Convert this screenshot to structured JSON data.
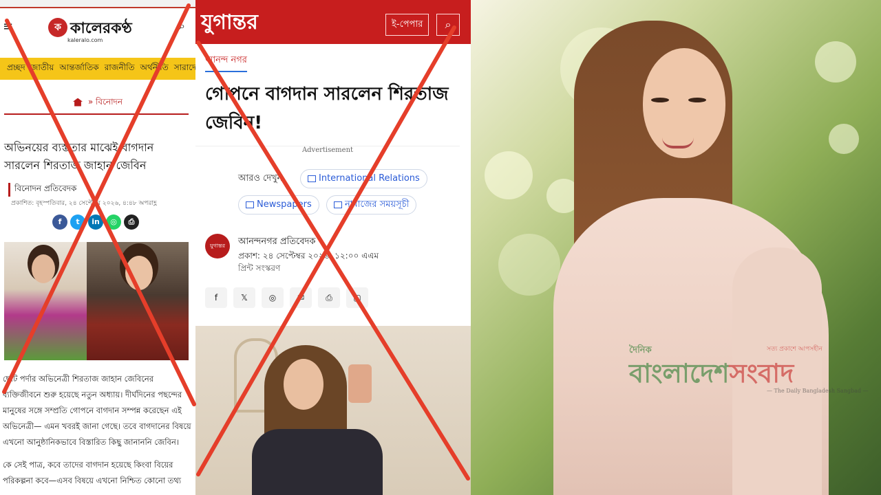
{
  "left": {
    "logo_text": "কালেরকণ্ঠ",
    "logo_sub": "kaleralo.com",
    "nav": [
      "প্রচ্ছদ",
      "জাতীয়",
      "আন্তর্জাতিক",
      "রাজনীতি",
      "অর্থনীতি",
      "সারাদেশ"
    ],
    "breadcrumb": "বিনোদন",
    "headline": "অভিনয়ের ব্যস্ততার মাঝেই বাগদান সারলেন শিরতাজ জাহান জেবিন",
    "author": "বিনোদন প্রতিবেদক",
    "date": "প্রকাশিত: বৃহস্পতিবার, ২৪ সেপ্টেম্বর ২০২৬, ৪:৪৮ অপরাহ্ণ",
    "body_p1": "ছোট পর্দার অভিনেত্রী শিরতাজ জাহান জেবিনের ব্যক্তিজীবনে শুরু হয়েছে নতুন অধ্যায়। দীর্ঘদিনের পছন্দের মানুষের সঙ্গে সম্প্রতি গোপনে বাগদান সম্পন্ন করেছেন এই অভিনেত্রী— এমন খবরই জানা গেছে। তবে বাগদানের বিষয়ে এখনো আনুষ্ঠানিকভাবে বিস্তারিত কিছু জানাননি জেবিন।",
    "body_p2": "কে সেই পাত্র, কবে তাদের বাগদান হয়েছে কিংবা বিয়ের পরিকল্পনা কবে—এসব বিষয়ে এখনো নিশ্চিত কোনো তথ্য"
  },
  "middle": {
    "logo_text": "যুগান্তর",
    "epaper": "ই-পেপার",
    "section": "আনন্দ নগর",
    "headline": "গোপনে বাগদান সারলেন শিরতাজ জেবিন!",
    "ad": "Advertisement",
    "more": "আরও দেখুন",
    "chips": [
      "International Relations",
      "Newspapers",
      "নামাজের সময়সূচী"
    ],
    "author_badge": "যুগান্তর",
    "author": "আনন্দনগর প্রতিবেদক",
    "date": "প্রকাশ: ২৪ সেপ্টেম্বর ২০২৬, ১২:০০ এএম",
    "print": "প্রিন্ট সংস্করণ",
    "share_icons": [
      "f",
      "𝕏",
      "◎",
      "✉",
      "⎙",
      "▢"
    ]
  },
  "right": {
    "wm_daily": "দৈনিক",
    "wm_tag": "সত্য প্রকাশে আপসহীন",
    "wm_main_a": "বাংলাদেশ",
    "wm_main_b": "সংবাদ",
    "wm_en": "— The Daily Bangladesh Sangbad —"
  },
  "colors": {
    "cross": "#e53e2a",
    "jugantor_red": "#c71e1e",
    "nav_yellow": "#f5c518"
  }
}
